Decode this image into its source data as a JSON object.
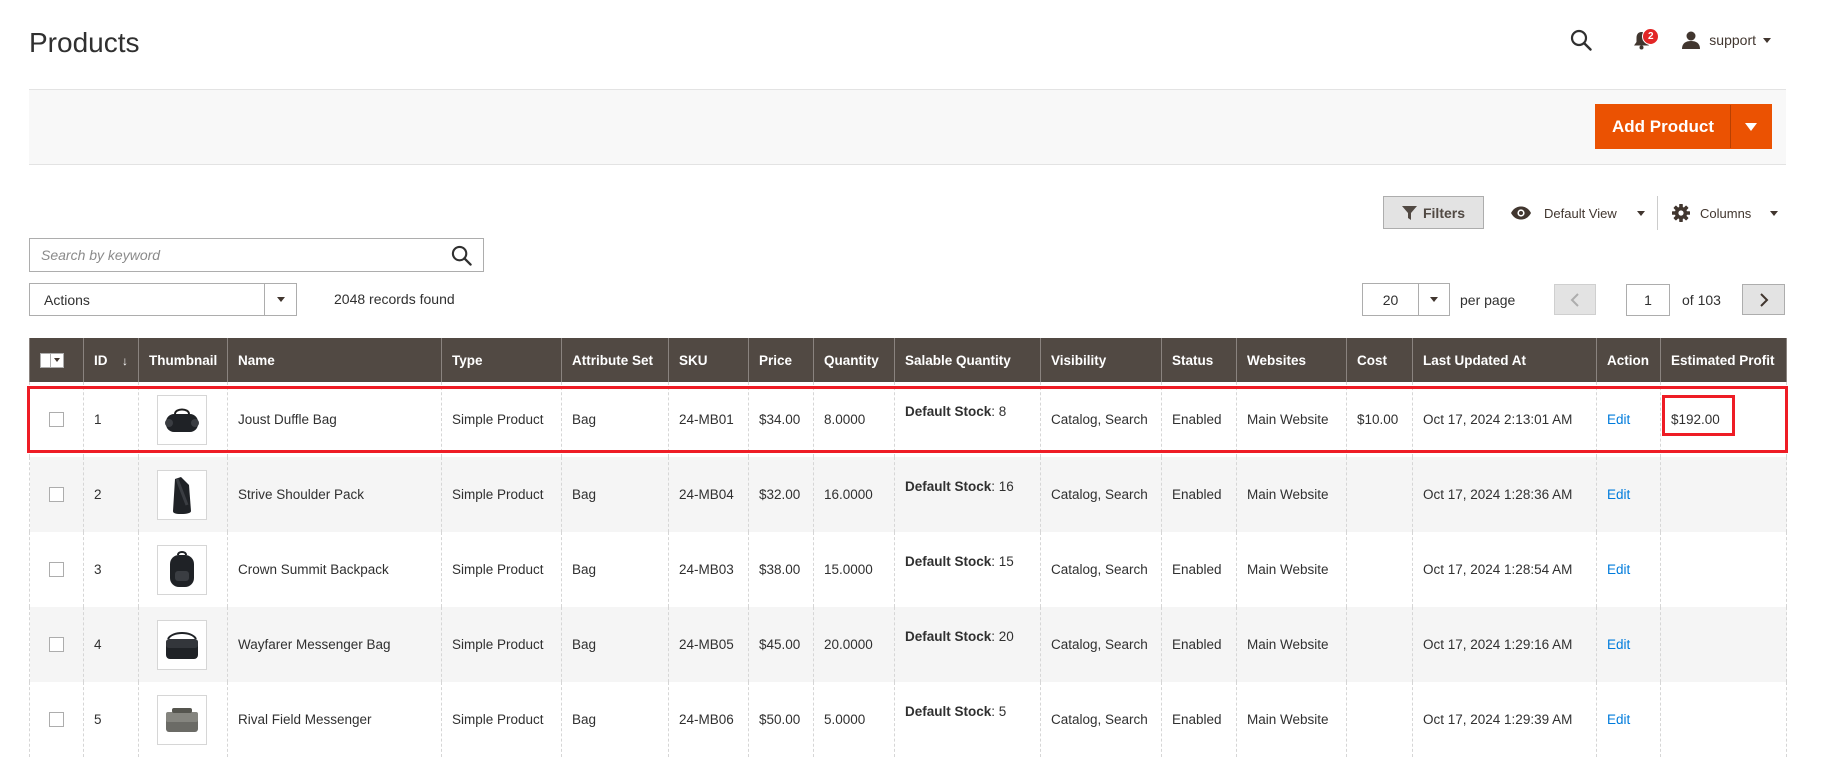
{
  "page": {
    "title": "Products"
  },
  "header": {
    "notification_count": "2",
    "user_name": "support"
  },
  "toolbar": {
    "add_product_label": "Add Product"
  },
  "grid_controls": {
    "filters_label": "Filters",
    "view_label": "Default View",
    "columns_label": "Columns",
    "search_placeholder": "Search by keyword",
    "actions_label": "Actions",
    "records_found": "2048 records found",
    "per_page_value": "20",
    "per_page_label": "per page",
    "current_page": "1",
    "total_pages": "of 103"
  },
  "table": {
    "columns": [
      "ID",
      "Thumbnail",
      "Name",
      "Type",
      "Attribute Set",
      "SKU",
      "Price",
      "Quantity",
      "Salable Quantity",
      "Visibility",
      "Status",
      "Websites",
      "Cost",
      "Last Updated At",
      "Action",
      "Estimated Profit"
    ],
    "sort_indicator": "↓",
    "stock_label": "Default Stock",
    "edit_label": "Edit",
    "rows": [
      {
        "id": "1",
        "name": "Joust Duffle Bag",
        "type": "Simple Product",
        "attribute_set": "Bag",
        "sku": "24-MB01",
        "price": "$34.00",
        "quantity": "8.0000",
        "salable": ": 8",
        "visibility": "Catalog, Search",
        "status": "Enabled",
        "websites": "Main Website",
        "cost": "$10.00",
        "updated": "Oct 17, 2024 2:13:01 AM",
        "profit": "$192.00",
        "thumb_icon": "duffle-bag-icon"
      },
      {
        "id": "2",
        "name": "Strive Shoulder Pack",
        "type": "Simple Product",
        "attribute_set": "Bag",
        "sku": "24-MB04",
        "price": "$32.00",
        "quantity": "16.0000",
        "salable": ": 16",
        "visibility": "Catalog, Search",
        "status": "Enabled",
        "websites": "Main Website",
        "cost": "",
        "updated": "Oct 17, 2024 1:28:36 AM",
        "profit": "",
        "thumb_icon": "shoulder-pack-icon"
      },
      {
        "id": "3",
        "name": "Crown Summit Backpack",
        "type": "Simple Product",
        "attribute_set": "Bag",
        "sku": "24-MB03",
        "price": "$38.00",
        "quantity": "15.0000",
        "salable": ": 15",
        "visibility": "Catalog, Search",
        "status": "Enabled",
        "websites": "Main Website",
        "cost": "",
        "updated": "Oct 17, 2024 1:28:54 AM",
        "profit": "",
        "thumb_icon": "backpack-icon"
      },
      {
        "id": "4",
        "name": "Wayfarer Messenger Bag",
        "type": "Simple Product",
        "attribute_set": "Bag",
        "sku": "24-MB05",
        "price": "$45.00",
        "quantity": "20.0000",
        "salable": ": 20",
        "visibility": "Catalog, Search",
        "status": "Enabled",
        "websites": "Main Website",
        "cost": "",
        "updated": "Oct 17, 2024 1:29:16 AM",
        "profit": "",
        "thumb_icon": "messenger-bag-icon"
      },
      {
        "id": "5",
        "name": "Rival Field Messenger",
        "type": "Simple Product",
        "attribute_set": "Bag",
        "sku": "24-MB06",
        "price": "$50.00",
        "quantity": "5.0000",
        "salable": ": 5",
        "visibility": "Catalog, Search",
        "status": "Enabled",
        "websites": "Main Website",
        "cost": "",
        "updated": "Oct 17, 2024 1:29:39 AM",
        "profit": "",
        "thumb_icon": "field-messenger-icon"
      }
    ]
  },
  "colors": {
    "accent": "#eb5202",
    "header_bg": "#514943",
    "link": "#007bdb",
    "highlight": "#ee1c25"
  }
}
